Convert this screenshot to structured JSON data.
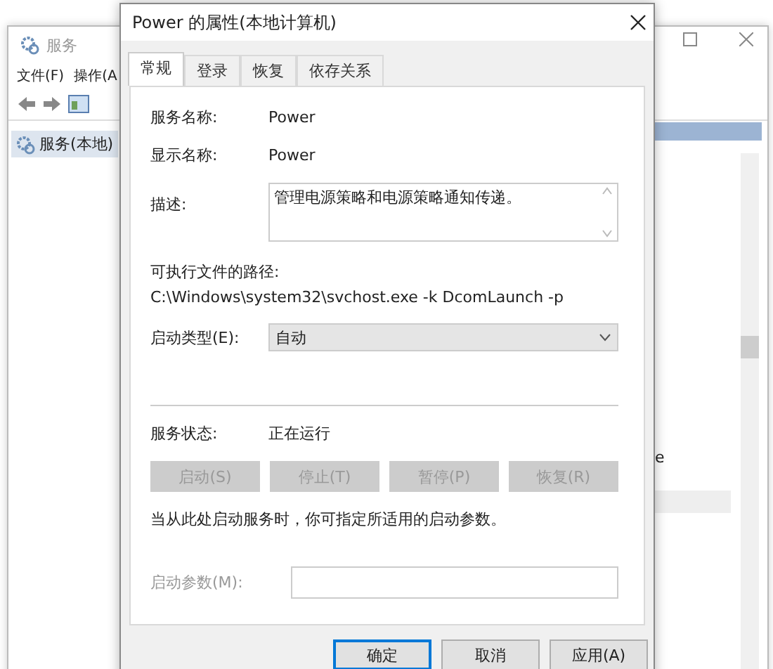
{
  "services_window": {
    "title": "服务",
    "menu": [
      "文件(F)",
      "操作(A"
    ],
    "tree": [
      {
        "label": "服务(本地)",
        "selected": true
      }
    ],
    "list_fragment": "e"
  },
  "dialog": {
    "title": "Power 的属性(本地计算机)",
    "tabs": [
      {
        "label": "常规",
        "selected": true
      },
      {
        "label": "登录",
        "selected": false
      },
      {
        "label": "恢复",
        "selected": false
      },
      {
        "label": "依存关系",
        "selected": false
      }
    ],
    "service_name": {
      "label": "服务名称:",
      "value": "Power"
    },
    "display_name": {
      "label": "显示名称:",
      "value": "Power"
    },
    "description": {
      "label": "描述:",
      "value": "管理电源策略和电源策略通知传递。"
    },
    "path": {
      "label": "可执行文件的路径:",
      "value": "C:\\Windows\\system32\\svchost.exe -k DcomLaunch -p"
    },
    "startup_type": {
      "label": "启动类型(E):",
      "value": "自动"
    },
    "status": {
      "label": "服务状态:",
      "value": "正在运行"
    },
    "service_buttons": [
      {
        "label": "启动(S)",
        "disabled": true
      },
      {
        "label": "停止(T)",
        "disabled": true
      },
      {
        "label": "暂停(P)",
        "disabled": true
      },
      {
        "label": "恢复(R)",
        "disabled": true
      }
    ],
    "hint": "当从此处启动服务时，你可指定所适用的启动参数。",
    "start_params": {
      "label": "启动参数(M):",
      "disabled": true
    },
    "buttons": [
      {
        "label": "确定",
        "default": true
      },
      {
        "label": "取消",
        "default": false
      },
      {
        "label": "应用(A)",
        "default": false
      }
    ]
  }
}
